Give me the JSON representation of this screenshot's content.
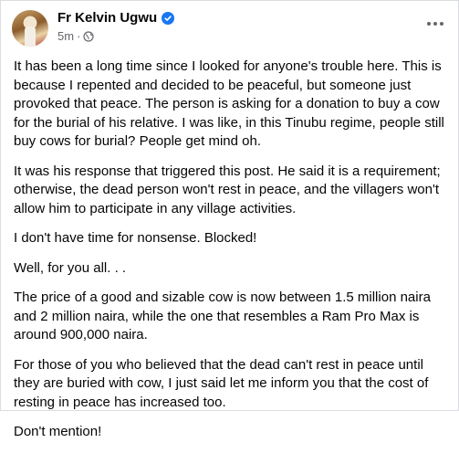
{
  "post": {
    "author": "Fr Kelvin Ugwu",
    "timestamp": "5m",
    "separator": "·",
    "verified_icon": "verified-badge-icon",
    "privacy_icon": "globe-icon",
    "more_icon": "more-horizontal-icon",
    "accent_color": "#1877f2",
    "paragraphs": [
      "It has been a long time since I looked for anyone's trouble here. This is because I repented and decided to be peaceful, but someone just provoked that peace. The person is asking for a donation to buy a cow for the burial of his relative. I was like, in this Tinubu regime, people still buy cows for burial? People get mind oh.",
      "It was his response that triggered this post. He said it is a requirement; otherwise, the dead person won't rest in peace, and the villagers won't allow him to participate in any village activities.",
      "I don't have time for nonsense. Blocked!",
      "Well, for you all. . .",
      "The price of a good and sizable cow is now between 1.5 million naira and 2 million naira, while the one that resembles a Ram Pro Max is around 900,000 naira.",
      "For those of you who believed that the dead can't rest in peace until they are buried with cow, I just said let me inform you that the cost of resting in peace has increased too.",
      "Don't mention!"
    ]
  }
}
